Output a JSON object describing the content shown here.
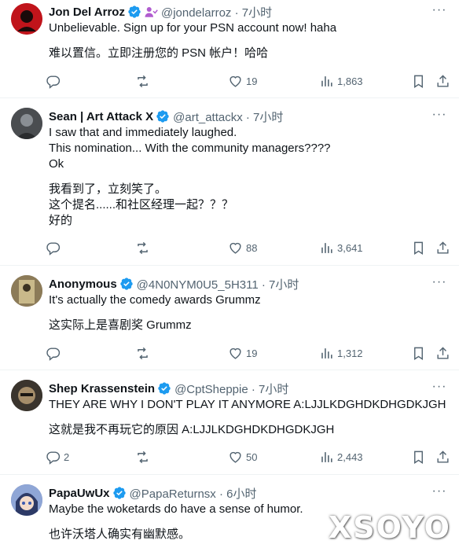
{
  "tweets": [
    {
      "name": "Jon Del Arroz",
      "handle": "@jondelarroz · 7小时",
      "lines": [
        "Unbelievable.  Sign up for your PSN account now! haha"
      ],
      "translation": [
        "难以置信。立即注册您的 PSN 帐户！哈哈"
      ],
      "replies": "",
      "likes": "19",
      "views": "1,863",
      "avatar_color": "#c0141b"
    },
    {
      "name": "Sean | Art Attack X",
      "handle": "@art_attackx · 7小时",
      "lines": [
        "I saw that and immediately laughed.",
        "This nomination... With the community managers????",
        "Ok"
      ],
      "translation": [
        "我看到了，立刻笑了。",
        "这个提名......和社区经理一起？？？",
        "好的"
      ],
      "replies": "",
      "likes": "88",
      "views": "3,641",
      "avatar_color": "#3a3d40"
    },
    {
      "name": "Anonymous",
      "handle": "@4N0NYM0U5_5H311 · 7小时",
      "lines": [
        "It's actually the comedy awards Grummz"
      ],
      "translation": [
        "这实际上是喜剧奖 Grummz"
      ],
      "replies": "",
      "likes": "19",
      "views": "1,312",
      "avatar_color": "#7a6a4a"
    },
    {
      "name": "Shep Krassenstein",
      "handle": "@CptSheppie · 7小时",
      "lines": [
        "THEY ARE WHY I DON'T PLAY IT ANYMORE A:LJJLKDGHDKDHGDKJGH"
      ],
      "translation": [
        "这就是我不再玩它的原因 A:LJJLKDGHDKDHGDKJGH"
      ],
      "replies": "2",
      "likes": "50",
      "views": "2,443",
      "avatar_color": "#2e2a26"
    },
    {
      "name": "PapaUwUx",
      "handle": "@PapaReturnsx · 6小时",
      "lines": [
        "Maybe the woketards do have a sense of humor."
      ],
      "translation": [
        "也许沃塔人确实有幽默感。"
      ],
      "replies": "",
      "likes": "",
      "views": "",
      "avatar_color": "#5b6ea8"
    }
  ],
  "more_label": "···",
  "watermark": "XSOYO",
  "colors": {
    "verified": "#1d9bf0",
    "muted": "#536471",
    "text": "#0f1419"
  }
}
